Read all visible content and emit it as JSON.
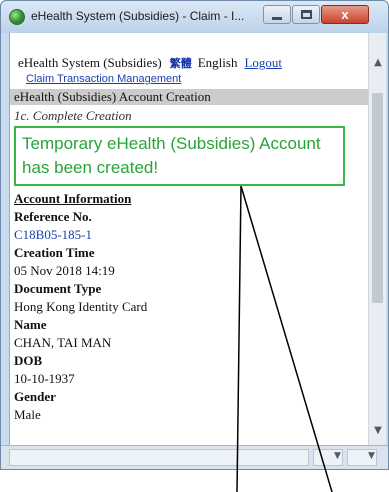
{
  "window": {
    "title": "eHealth System (Subsidies) - Claim - I...",
    "close_glyph": "x"
  },
  "header": {
    "system_name": "eHealth System (Subsidies)",
    "lang_icon": "繁體",
    "english_label": "English",
    "logout_label": "Logout",
    "claim_link": "Claim Transaction Management"
  },
  "section": {
    "title": "eHealth (Subsidies) Account Creation",
    "step": "1c. Complete Creation"
  },
  "message": {
    "success": "Temporary eHealth (Subsidies) Account has been created!",
    "color": "#2aa33a"
  },
  "account": {
    "heading": "Account Information",
    "fields": [
      {
        "label": "Reference No.",
        "value": "C18B05-185-1"
      },
      {
        "label": "Creation Time",
        "value": "05 Nov 2018 14:19"
      },
      {
        "label": "Document Type",
        "value": "Hong Kong Identity Card"
      },
      {
        "label": "Name",
        "value": "CHAN, TAI MAN"
      },
      {
        "label": "DOB",
        "value": "10-10-1937"
      },
      {
        "label": "Gender",
        "value": "Male"
      }
    ]
  },
  "icons": {
    "app": "ehealth-globe-icon",
    "scroll_up": "▲",
    "scroll_down": "▼",
    "status_dropdown": "▼"
  },
  "colors": {
    "link": "#1a3fb5",
    "success_border": "#39b54a",
    "section_bar": "#cccccc"
  }
}
